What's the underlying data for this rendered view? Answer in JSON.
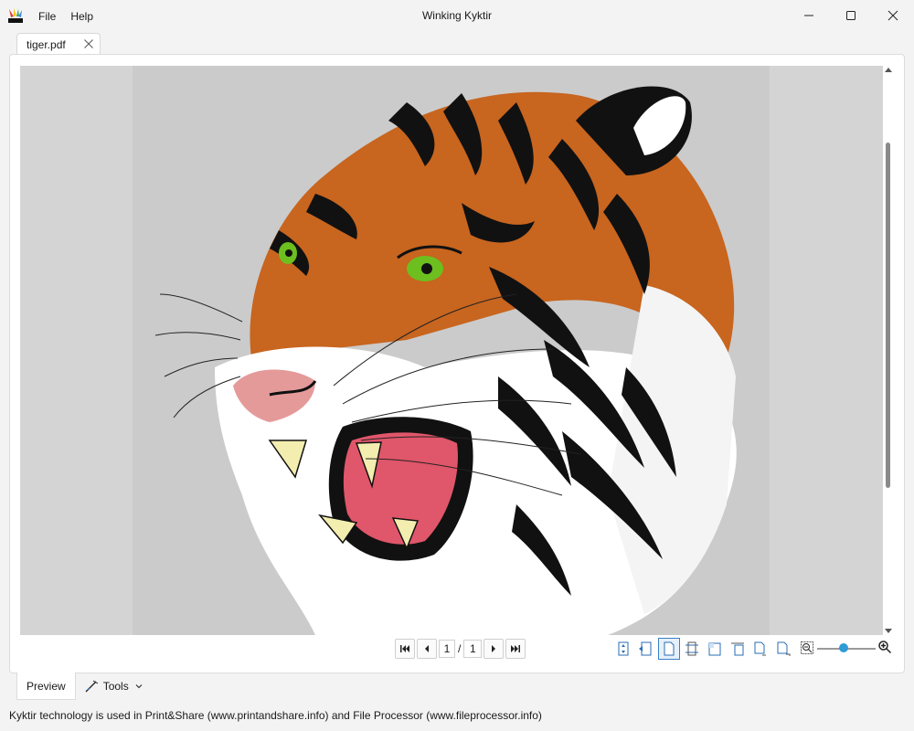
{
  "window": {
    "title": "Winking Kyktir",
    "menu": [
      "File",
      "Help"
    ]
  },
  "tabs": [
    {
      "label": "tiger.pdf",
      "active": true
    }
  ],
  "navigation": {
    "current_page": "1",
    "separator": "/",
    "total_pages": "1"
  },
  "view_tools": [
    "fit-width-icon",
    "fit-page-icon",
    "single-page-icon",
    "crop-icon",
    "two-page-icon",
    "continuous-icon",
    "rotate-left-icon",
    "rotate-right-icon"
  ],
  "zoom": {
    "level_fraction": 0.45
  },
  "bottom_tabs": {
    "preview": "Preview",
    "tools": "Tools"
  },
  "status": "Kyktir technology is used in Print&Share (www.printandshare.info) and File Processor (www.fileprocessor.info)",
  "colors": {
    "accent": "#2f9bd6",
    "tiger_orange": "#c8651f",
    "eye_green": "#6cbf1f",
    "mouth_pink": "#e0566a"
  }
}
